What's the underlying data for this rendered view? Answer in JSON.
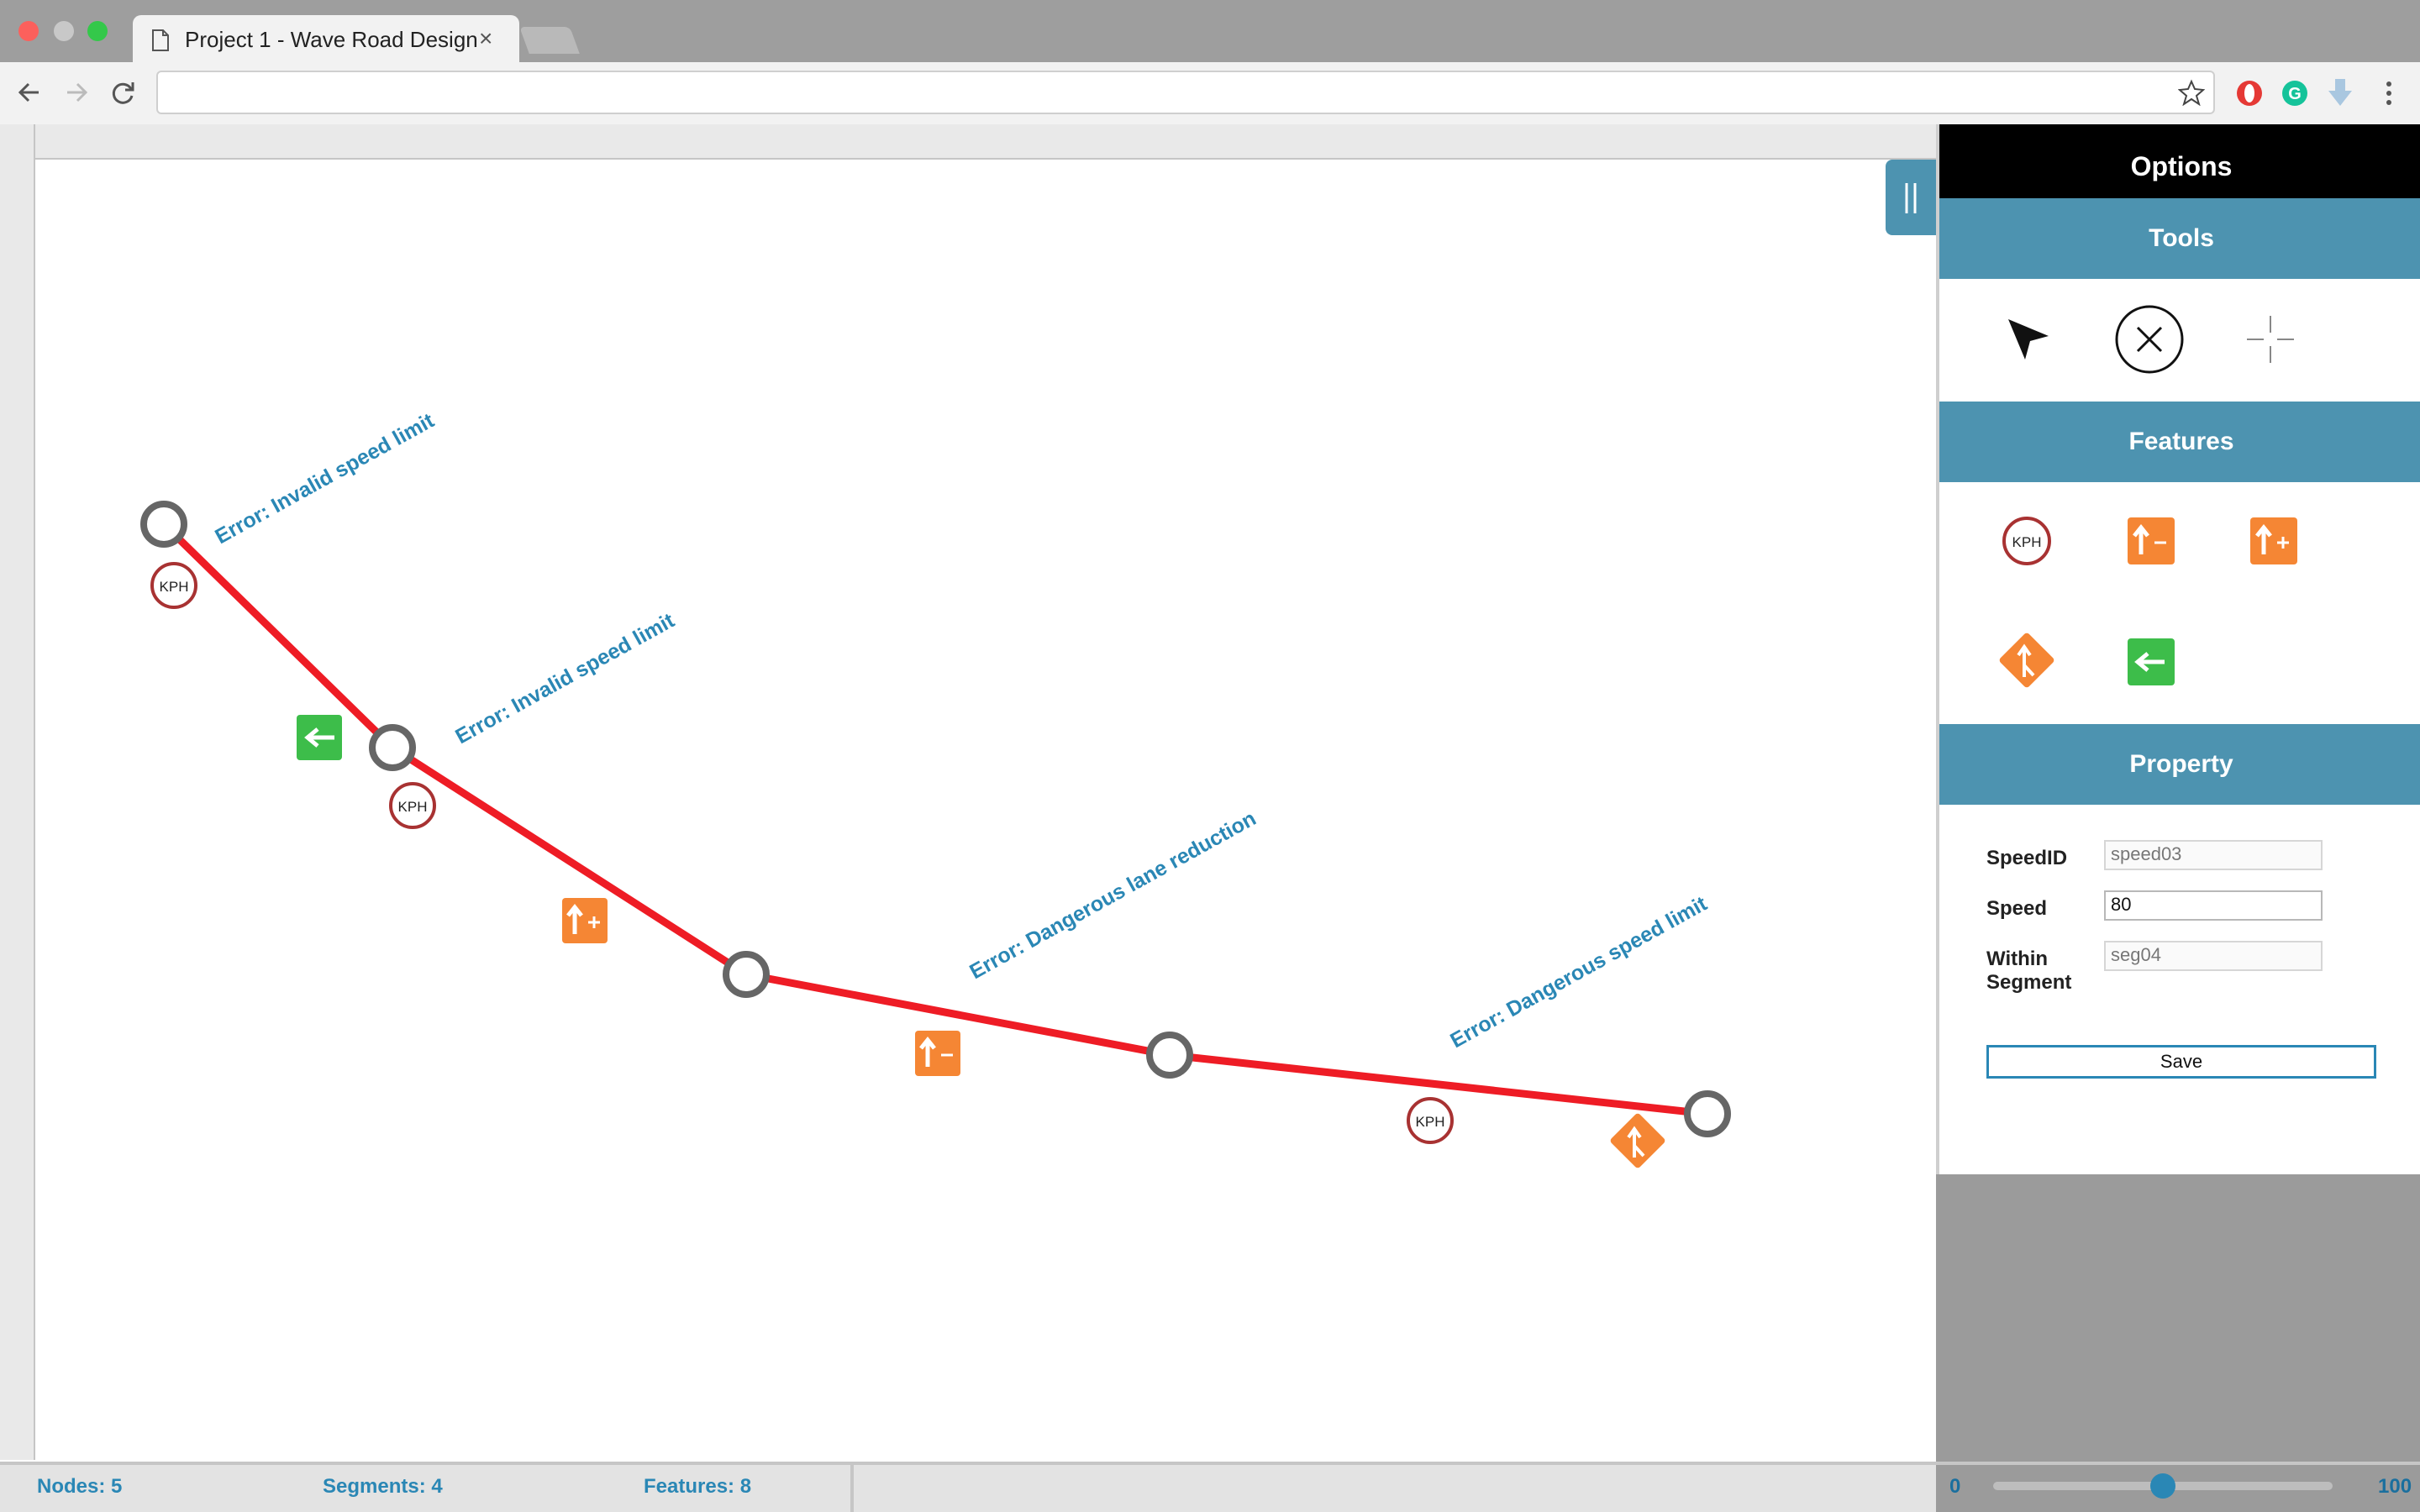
{
  "browser": {
    "tab_title": "Project 1 - Wave Road Design",
    "tab_close": "×",
    "url": ""
  },
  "panel": {
    "title": "Options",
    "sections": {
      "tools": "Tools",
      "features": "Features",
      "property": "Property"
    },
    "tools": [
      "select-arrow-icon",
      "delete-circle-x-icon",
      "crosshair-icon"
    ],
    "features": [
      "speed-limit-kph-icon",
      "lane-reduction-icon",
      "lane-addition-icon",
      "merge-sign-icon",
      "turn-left-arrow-icon"
    ],
    "feature_kph_text": "KPH"
  },
  "property": {
    "speedid_label": "SpeedID",
    "speedid_value": "speed03",
    "speed_label": "Speed",
    "speed_value": "80",
    "segment_label_1": "Within",
    "segment_label_2": "Segment",
    "segment_value": "seg04",
    "save_label": "Save"
  },
  "status": {
    "nodes": "Nodes: 5",
    "segments": "Segments: 4",
    "features": "Features: 8"
  },
  "slider": {
    "min": "0",
    "max": "100",
    "value": 50
  },
  "canvas": {
    "errors": [
      "Error: Invalid speed limit",
      "Error: Invalid speed limit",
      "Error: Dangerous lane reduction",
      "Error: Dangerous speed limit"
    ],
    "kph_text": "KPH",
    "road_color": "#ee1c25",
    "node_color": "#666666",
    "error_color": "#2a87b5"
  },
  "colors": {
    "accent": "#4d93b0",
    "orange": "#f58634",
    "green": "#3dbd4a",
    "kph_ring": "#a83232"
  }
}
